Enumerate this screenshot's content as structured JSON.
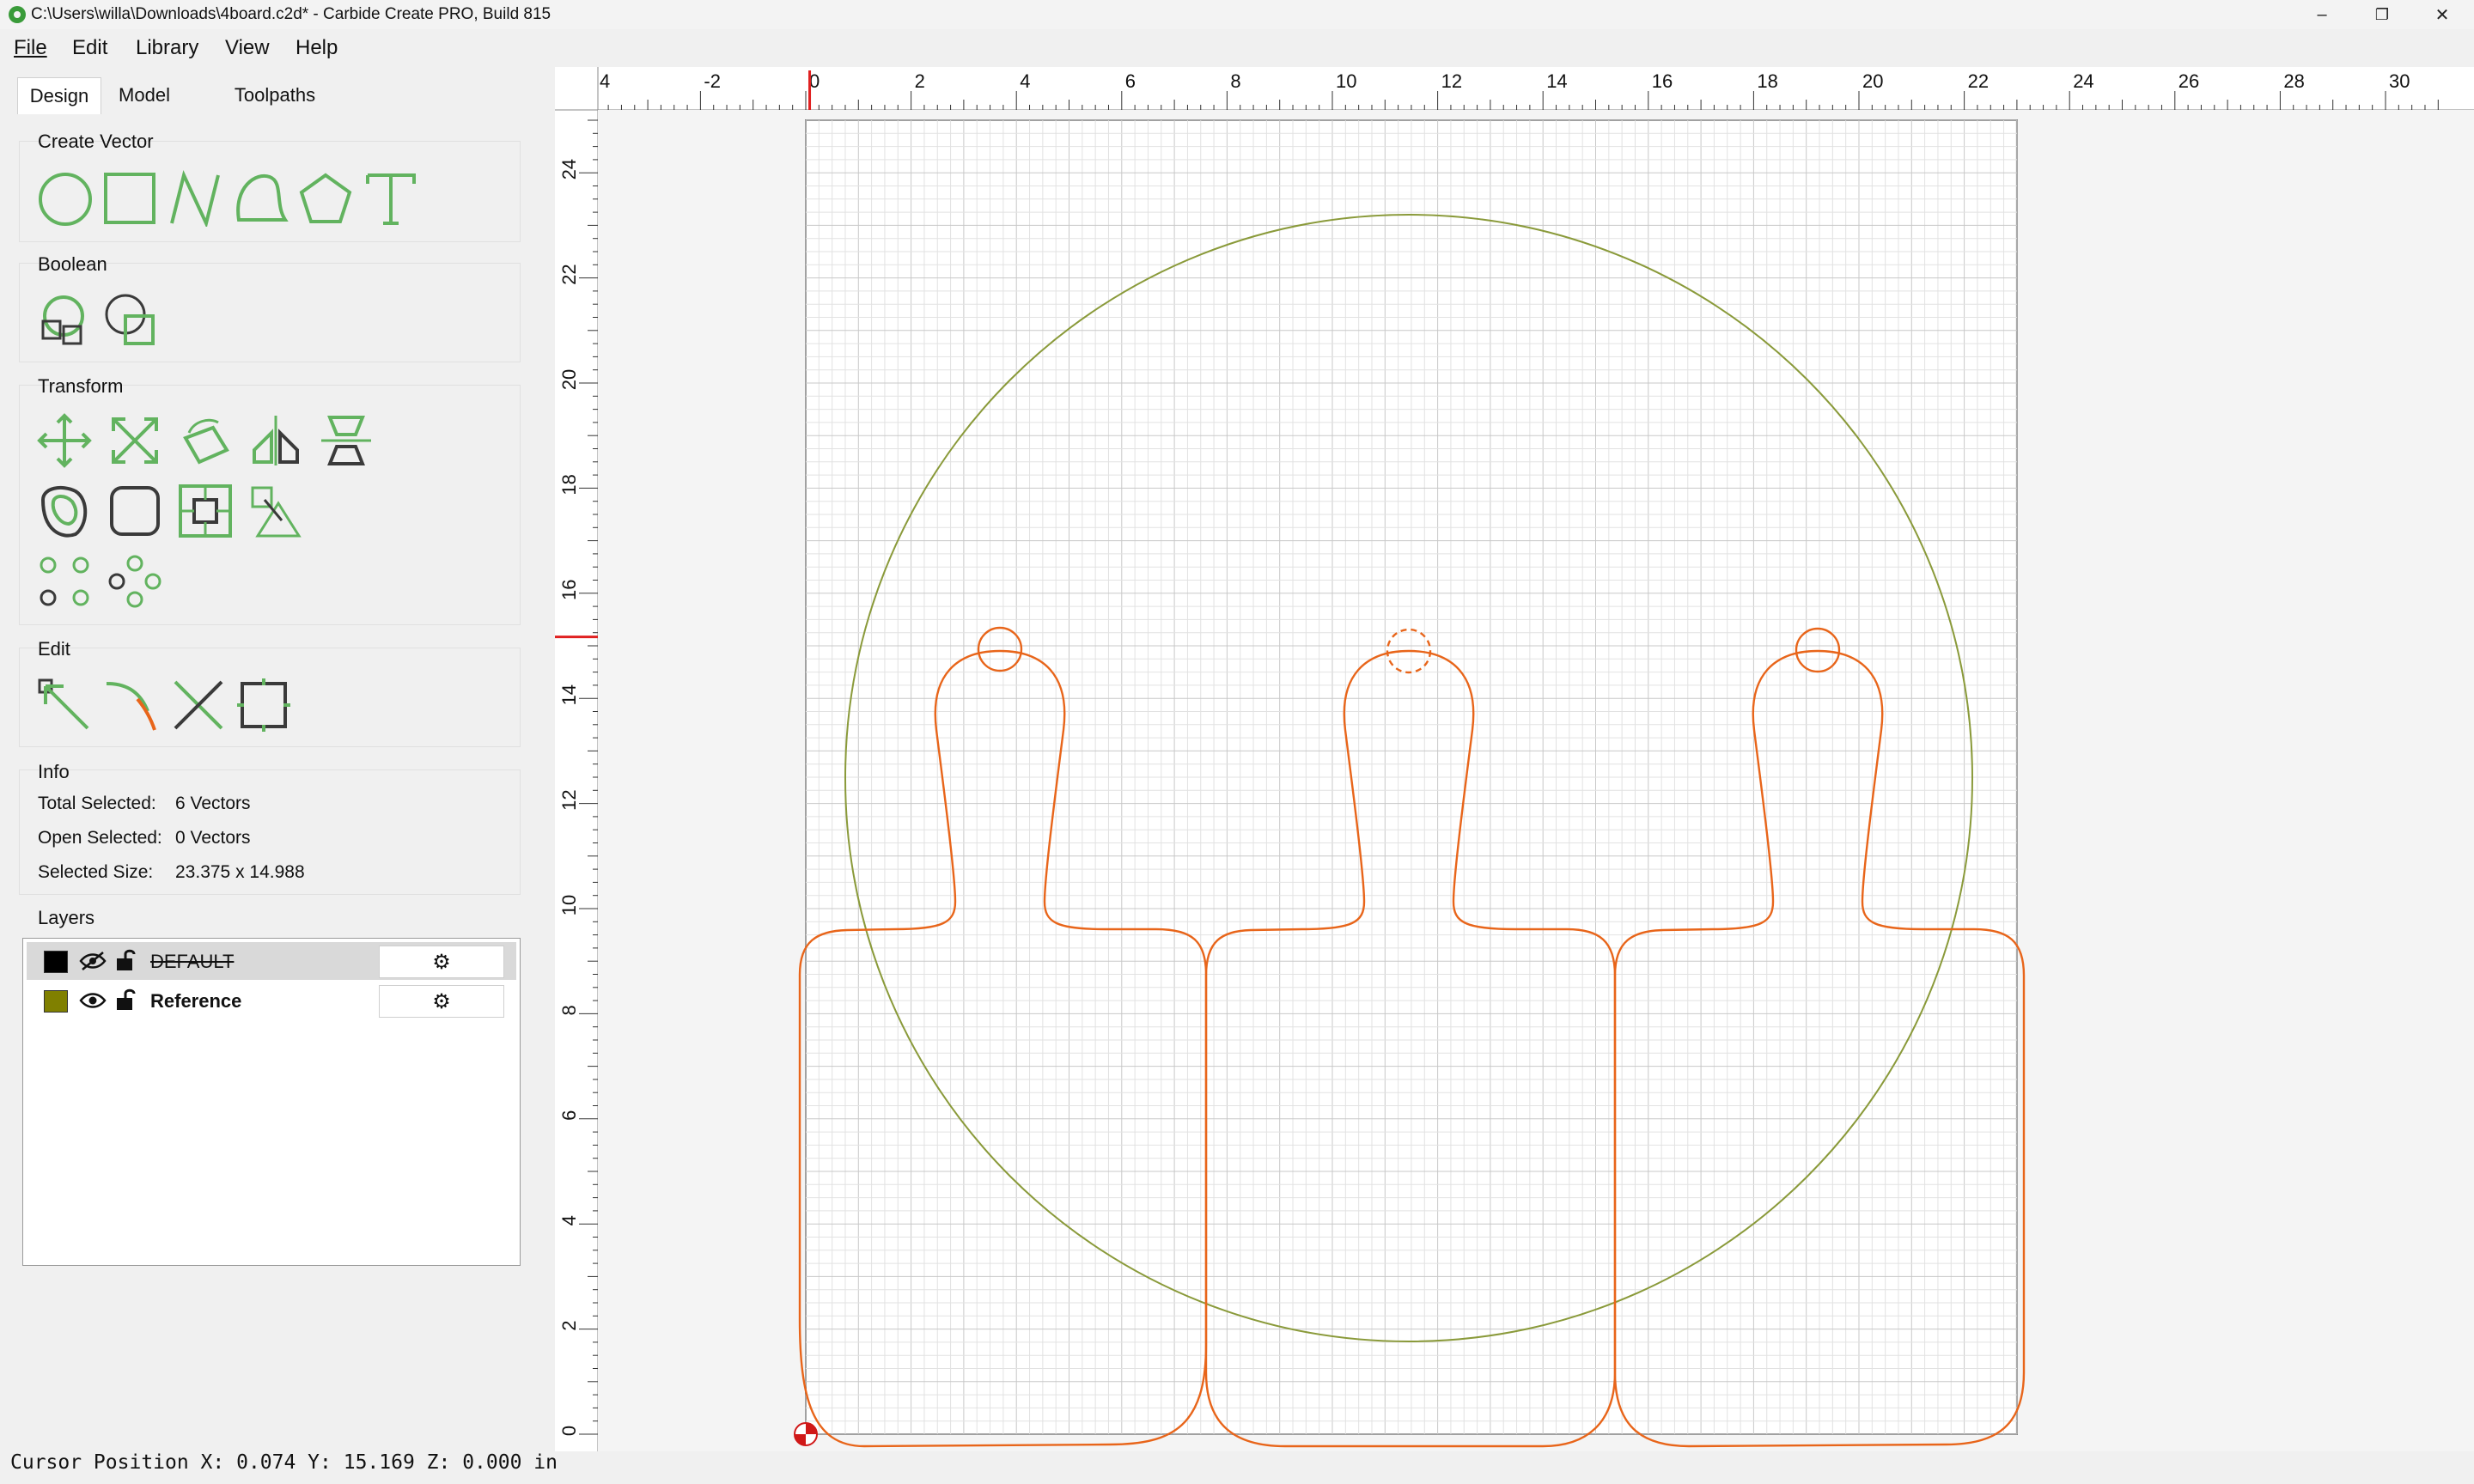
{
  "window": {
    "title": "C:\\Users\\willa\\Downloads\\4board.c2d* - Carbide Create PRO, Build 815",
    "minimize_icon": "minimize-icon",
    "restore_icon": "restore-icon",
    "close_icon": "close-icon"
  },
  "menu": {
    "items": [
      "File",
      "Edit",
      "Library",
      "View",
      "Help"
    ]
  },
  "tabs": [
    "Design",
    "Model",
    "Toolpaths"
  ],
  "active_tab": "Design",
  "groups": {
    "create_vector": {
      "title": "Create Vector",
      "tools": [
        "circle-tool-icon",
        "rectangle-tool-icon",
        "polyline-tool-icon",
        "curve-tool-icon",
        "polygon-tool-icon",
        "text-tool-icon"
      ]
    },
    "boolean": {
      "title": "Boolean",
      "tools": [
        "union-icon",
        "subtract-icon"
      ]
    },
    "transform": {
      "title": "Transform",
      "tools": [
        "move-icon",
        "scale-icon",
        "rotate-icon",
        "mirror-icon",
        "align-icon",
        "offset-icon",
        "fillet-icon",
        "inset-icon",
        "pattern-icon",
        "grid-array-icon",
        "circular-array-icon"
      ]
    },
    "edit": {
      "title": "Edit",
      "tools": [
        "node-edit-icon",
        "trim-icon",
        "cut-icon",
        "bounding-box-icon"
      ]
    }
  },
  "info": {
    "title": "Info",
    "total_label": "Total Selected:",
    "total_value": "6 Vectors",
    "open_label": "Open Selected:",
    "open_value": "0 Vectors",
    "size_label": "Selected Size:",
    "size_value": "23.375 x 14.988"
  },
  "layers": {
    "title": "Layers",
    "items": [
      {
        "name": "DEFAULT",
        "color": "#000000",
        "visible": false,
        "locked": false,
        "selected": true
      },
      {
        "name": "Reference",
        "color": "#808000",
        "visible": true,
        "locked": false,
        "selected": false
      }
    ]
  },
  "status": {
    "cursor": "Cursor Position X: 0.074 Y: 15.169 Z: 0.000 in"
  },
  "rulers": {
    "top_ticks": [
      "4",
      "-2",
      "0",
      "2",
      "4",
      "6",
      "8",
      "10",
      "12",
      "14",
      "16",
      "18",
      "20",
      "22",
      "24",
      "26",
      "28",
      "30"
    ],
    "left_ticks": [
      "0",
      "2",
      "4",
      "6",
      "8",
      "10",
      "12",
      "14",
      "16",
      "18",
      "20",
      "22",
      "24"
    ],
    "cursor_x": 0.074,
    "cursor_y": 15.169
  },
  "stock": {
    "width": 23,
    "height": 25
  },
  "colors": {
    "vector": "#e8651a",
    "reference": "#8a9a3a",
    "grid": "#d8d8d8",
    "tool_green": "#62b35f",
    "tool_dark": "#3a3a3a"
  }
}
